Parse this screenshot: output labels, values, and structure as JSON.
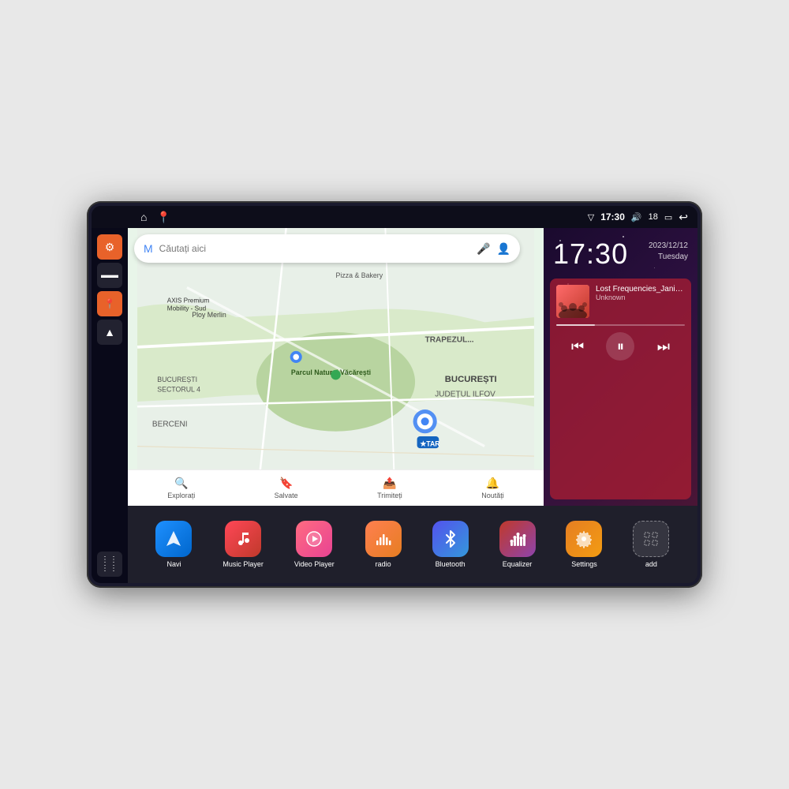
{
  "device": {
    "status_bar": {
      "wifi_icon": "▼",
      "time": "17:30",
      "volume_icon": "🔊",
      "battery_level": "18",
      "battery_icon": "🔋",
      "back_icon": "↩"
    },
    "sidebar": {
      "items": [
        {
          "name": "home",
          "icon": "⊏",
          "label": "Home"
        },
        {
          "name": "maps",
          "icon": "📍",
          "label": "Maps"
        },
        {
          "name": "settings",
          "icon": "⚙",
          "label": "Settings",
          "color": "orange"
        },
        {
          "name": "files",
          "icon": "▬",
          "label": "Files",
          "color": "dark"
        },
        {
          "name": "location",
          "icon": "📍",
          "label": "Location",
          "color": "orange"
        },
        {
          "name": "navigation",
          "icon": "▲",
          "label": "Navigation",
          "color": "dark"
        },
        {
          "name": "apps",
          "icon": "⋮⋮⋮",
          "label": "Apps Grid"
        }
      ]
    },
    "map": {
      "search_placeholder": "Căutați aici",
      "bottom_items": [
        {
          "icon": "🔍",
          "label": "Explorați"
        },
        {
          "icon": "🔖",
          "label": "Salvate"
        },
        {
          "icon": "📤",
          "label": "Trimiteți"
        },
        {
          "icon": "🔔",
          "label": "Noutăți"
        }
      ]
    },
    "clock": {
      "time": "17:30",
      "date_year": "2023/12/12",
      "date_day": "Tuesday"
    },
    "music": {
      "title": "Lost Frequencies_Janie...",
      "artist": "Unknown",
      "progress": 30
    },
    "apps": [
      {
        "id": "navi",
        "label": "Navi",
        "icon": "▲",
        "color": "navi"
      },
      {
        "id": "music-player",
        "label": "Music Player",
        "icon": "♫",
        "color": "music"
      },
      {
        "id": "video-player",
        "label": "Video Player",
        "icon": "▶",
        "color": "video"
      },
      {
        "id": "radio",
        "label": "radio",
        "icon": "📻",
        "color": "radio"
      },
      {
        "id": "bluetooth",
        "label": "Bluetooth",
        "icon": "⚡",
        "color": "bt"
      },
      {
        "id": "equalizer",
        "label": "Equalizer",
        "icon": "📊",
        "color": "eq"
      },
      {
        "id": "settings",
        "label": "Settings",
        "icon": "⚙",
        "color": "settings"
      },
      {
        "id": "add",
        "label": "add",
        "icon": "+",
        "color": "add"
      }
    ],
    "colors": {
      "bg_dark": "#0d0d1a",
      "sidebar_bg": "#0a0a19",
      "right_panel_gradient_start": "#1a0a2e",
      "right_panel_gradient_end": "#4a1535",
      "orange_accent": "#e8622a",
      "music_bg": "rgba(180,30,50,0.7)"
    }
  }
}
